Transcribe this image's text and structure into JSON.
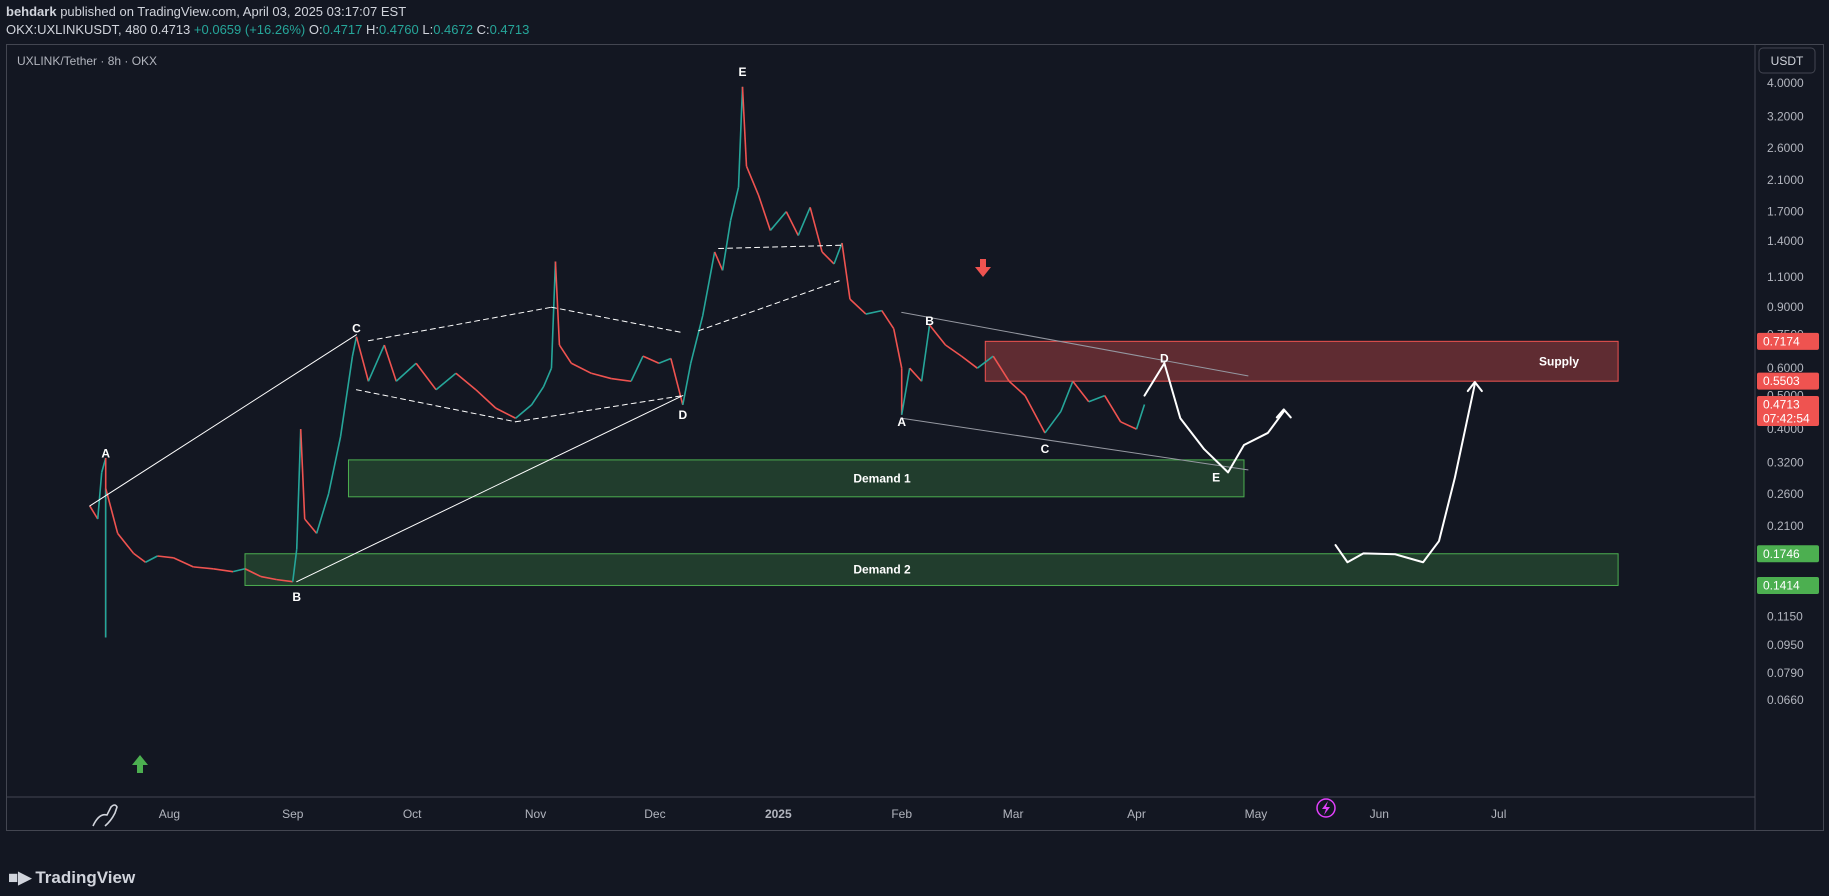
{
  "header": {
    "author": "behdark",
    "published_text": "published on TradingView.com, April 03, 2025 03:17:07 EST",
    "symbol_line": "OKX:UXLINKUSDT, 480",
    "last": "0.4713",
    "change": "+0.0659 (+16.26%)",
    "o_label": "O:",
    "o": "0.4717",
    "h_label": "H:",
    "h": "0.4760",
    "l_label": "L:",
    "l": "0.4672",
    "c_label": "C:",
    "c": "0.4713"
  },
  "chart_title": "UXLINK/Tether · 8h · OKX",
  "currency_button": "USDT",
  "footer": {
    "brand": "TradingView"
  },
  "colors": {
    "background": "#131722",
    "up": "#26a69a",
    "down": "#ef5350",
    "supply_zone": "#ef5350",
    "demand_zone": "#4caf50",
    "drawing": "#ffffff"
  },
  "chart_data": {
    "type": "candlestick",
    "symbol": "UXLINKUSDT",
    "exchange": "OKX",
    "interval": "8h",
    "scale": "log",
    "y_ticks": [
      "4.0000",
      "3.2000",
      "2.6000",
      "2.1000",
      "1.7000",
      "1.4000",
      "1.1000",
      "0.9000",
      "0.7500",
      "0.6000",
      "0.5000",
      "0.4000",
      "0.3200",
      "0.2600",
      "0.2100",
      "0.1700",
      "0.1400",
      "0.1150",
      "0.0950",
      "0.0790",
      "0.0660"
    ],
    "x_ticks": [
      "Aug",
      "Sep",
      "Oct",
      "Nov",
      "Dec",
      "2025",
      "Feb",
      "Mar",
      "Apr",
      "May",
      "Jun",
      "Jul"
    ],
    "price_labels": [
      {
        "label": "0.7174",
        "kind": "supply"
      },
      {
        "label": "0.5503",
        "kind": "supply"
      },
      {
        "label": "0.4713",
        "kind": "last",
        "countdown": "07:42:54"
      },
      {
        "label": "0.1746",
        "kind": "demand"
      },
      {
        "label": "0.1414",
        "kind": "demand"
      }
    ],
    "zones": [
      {
        "name": "Supply",
        "top": 0.7174,
        "bottom": 0.5503,
        "from": "2025-02-22",
        "to": "2025-07-31",
        "kind": "supply"
      },
      {
        "name": "Demand 1",
        "top": 0.326,
        "bottom": 0.255,
        "from": "2024-09-15",
        "to": "2025-04-28",
        "kind": "demand"
      },
      {
        "name": "Demand 2",
        "top": 0.1746,
        "bottom": 0.1414,
        "from": "2024-08-20",
        "to": "2025-07-31",
        "kind": "demand"
      }
    ],
    "wave_labels": [
      {
        "text": "A",
        "date": "2024-07-16",
        "price": 0.34
      },
      {
        "text": "B",
        "date": "2024-09-02",
        "price": 0.131
      },
      {
        "text": "C",
        "date": "2024-09-17",
        "price": 0.78
      },
      {
        "text": "D",
        "date": "2024-12-08",
        "price": 0.44
      },
      {
        "text": "E",
        "date": "2024-12-23",
        "price": 4.3
      },
      {
        "text": "A",
        "date": "2025-02-01",
        "price": 0.42
      },
      {
        "text": "B",
        "date": "2025-02-08",
        "price": 0.82
      },
      {
        "text": "C",
        "date": "2025-03-09",
        "price": 0.35
      },
      {
        "text": "D",
        "date": "2025-04-08",
        "price": 0.64
      },
      {
        "text": "E",
        "date": "2025-04-21",
        "price": 0.29
      }
    ],
    "price_path": [
      [
        "2024-07-12",
        0.24
      ],
      [
        "2024-07-14",
        0.22
      ],
      [
        "2024-07-15",
        0.3
      ],
      [
        "2024-07-16",
        0.33
      ],
      [
        "2024-07-16",
        0.1
      ],
      [
        "2024-07-16",
        0.27
      ],
      [
        "2024-07-19",
        0.2
      ],
      [
        "2024-07-23",
        0.175
      ],
      [
        "2024-07-26",
        0.165
      ],
      [
        "2024-07-29",
        0.172
      ],
      [
        "2024-08-02",
        0.17
      ],
      [
        "2024-08-07",
        0.16
      ],
      [
        "2024-08-12",
        0.158
      ],
      [
        "2024-08-17",
        0.155
      ],
      [
        "2024-08-20",
        0.158
      ],
      [
        "2024-08-24",
        0.15
      ],
      [
        "2024-08-28",
        0.147
      ],
      [
        "2024-09-01",
        0.145
      ],
      [
        "2024-09-02",
        0.18
      ],
      [
        "2024-09-03",
        0.4
      ],
      [
        "2024-09-04",
        0.22
      ],
      [
        "2024-09-07",
        0.2
      ],
      [
        "2024-09-10",
        0.26
      ],
      [
        "2024-09-13",
        0.38
      ],
      [
        "2024-09-16",
        0.65
      ],
      [
        "2024-09-17",
        0.74
      ],
      [
        "2024-09-20",
        0.55
      ],
      [
        "2024-09-24",
        0.7
      ],
      [
        "2024-09-27",
        0.55
      ],
      [
        "2024-10-02",
        0.62
      ],
      [
        "2024-10-07",
        0.52
      ],
      [
        "2024-10-12",
        0.58
      ],
      [
        "2024-10-17",
        0.52
      ],
      [
        "2024-10-22",
        0.46
      ],
      [
        "2024-10-27",
        0.43
      ],
      [
        "2024-10-31",
        0.47
      ],
      [
        "2024-11-03",
        0.53
      ],
      [
        "2024-11-05",
        0.6
      ],
      [
        "2024-11-06",
        1.22
      ],
      [
        "2024-11-07",
        0.7
      ],
      [
        "2024-11-10",
        0.62
      ],
      [
        "2024-11-15",
        0.58
      ],
      [
        "2024-11-20",
        0.56
      ],
      [
        "2024-11-25",
        0.55
      ],
      [
        "2024-11-28",
        0.65
      ],
      [
        "2024-12-02",
        0.62
      ],
      [
        "2024-12-05",
        0.64
      ],
      [
        "2024-12-08",
        0.47
      ],
      [
        "2024-12-10",
        0.62
      ],
      [
        "2024-12-13",
        0.85
      ],
      [
        "2024-12-16",
        1.3
      ],
      [
        "2024-12-18",
        1.15
      ],
      [
        "2024-12-20",
        1.6
      ],
      [
        "2024-12-22",
        2.0
      ],
      [
        "2024-12-23",
        3.9
      ],
      [
        "2024-12-24",
        2.3
      ],
      [
        "2024-12-27",
        1.9
      ],
      [
        "2024-12-30",
        1.5
      ],
      [
        "2025-01-03",
        1.7
      ],
      [
        "2025-01-06",
        1.45
      ],
      [
        "2025-01-09",
        1.75
      ],
      [
        "2025-01-12",
        1.3
      ],
      [
        "2025-01-15",
        1.2
      ],
      [
        "2025-01-17",
        1.38
      ],
      [
        "2025-01-19",
        0.95
      ],
      [
        "2025-01-23",
        0.86
      ],
      [
        "2025-01-27",
        0.88
      ],
      [
        "2025-01-30",
        0.78
      ],
      [
        "2025-02-01",
        0.6
      ],
      [
        "2025-02-01",
        0.44
      ],
      [
        "2025-02-03",
        0.6
      ],
      [
        "2025-02-06",
        0.55
      ],
      [
        "2025-02-08",
        0.8
      ],
      [
        "2025-02-12",
        0.7
      ],
      [
        "2025-02-16",
        0.65
      ],
      [
        "2025-02-20",
        0.6
      ],
      [
        "2025-02-24",
        0.65
      ],
      [
        "2025-02-28",
        0.55
      ],
      [
        "2025-03-04",
        0.5
      ],
      [
        "2025-03-09",
        0.39
      ],
      [
        "2025-03-13",
        0.45
      ],
      [
        "2025-03-16",
        0.55
      ],
      [
        "2025-03-20",
        0.48
      ],
      [
        "2025-03-24",
        0.5
      ],
      [
        "2025-03-28",
        0.42
      ],
      [
        "2025-04-01",
        0.4
      ],
      [
        "2025-04-03",
        0.4713
      ]
    ]
  }
}
